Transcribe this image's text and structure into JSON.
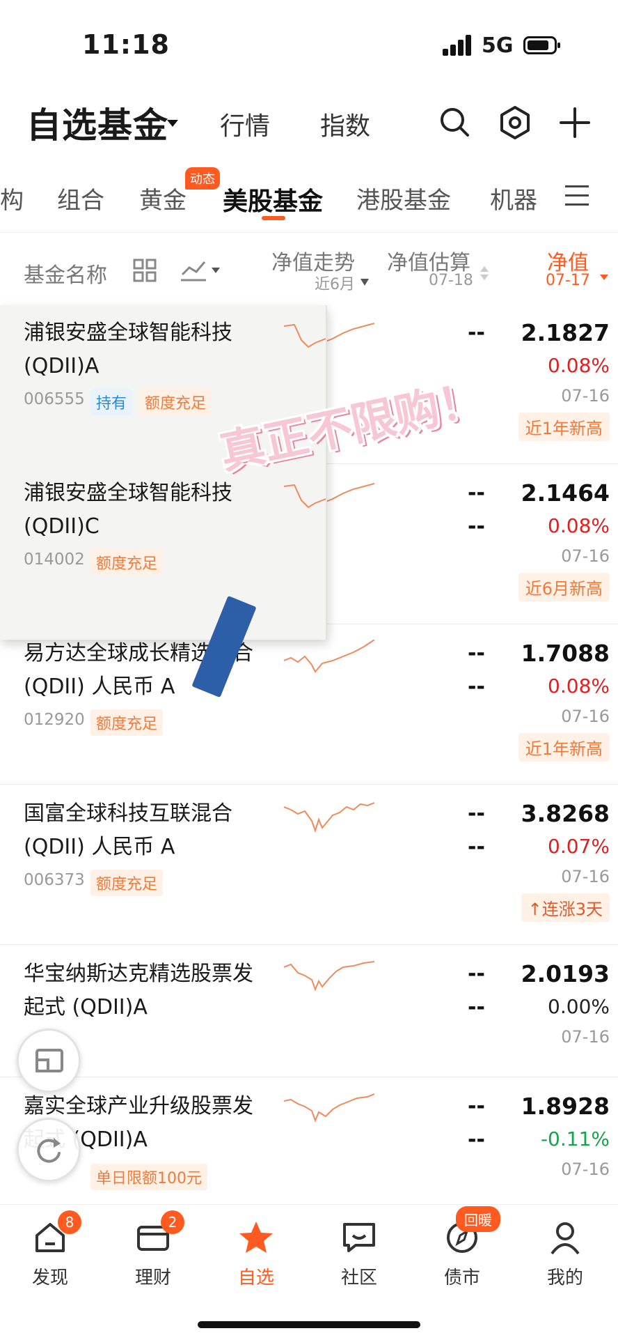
{
  "status": {
    "time": "11:18",
    "network": "5G"
  },
  "header": {
    "title": "自选基金",
    "nav": [
      "行情",
      "指数"
    ]
  },
  "tabs": {
    "items": [
      "构",
      "组合",
      "黄金",
      "美股基金",
      "港股基金",
      "机器"
    ],
    "active": "美股基金",
    "badge": "动态"
  },
  "columns": {
    "name": "基金名称",
    "trend": "净值走势",
    "trend_sub": "近6月",
    "estimate": "净值估算",
    "estimate_sub": "07-18",
    "nav": "净值",
    "nav_sub": "07-17"
  },
  "funds": [
    {
      "name": "浦银安盛全球智能科技 (QDII)A",
      "code": "006555",
      "chips": [
        "持有",
        "额度充足"
      ],
      "est1": "--",
      "est2": "",
      "nav": "2.1827",
      "pct": "0.08%",
      "dir": "up",
      "date": "07-16",
      "tag": "近1年新高"
    },
    {
      "name": "浦银安盛全球智能科技 (QDII)C",
      "code": "014002",
      "chips": [
        "额度充足"
      ],
      "est1": "--",
      "est2": "--",
      "nav": "2.1464",
      "pct": "0.08%",
      "dir": "up",
      "date": "07-16",
      "tag": "近6月新高"
    },
    {
      "name": "易方达全球成长精选混合 (QDII) 人民币 A",
      "code": "012920",
      "chips": [
        "额度充足"
      ],
      "est1": "--",
      "est2": "--",
      "nav": "1.7088",
      "pct": "0.08%",
      "dir": "up",
      "date": "07-16",
      "tag": "近1年新高"
    },
    {
      "name": "国富全球科技互联混合 (QDII) 人民币 A",
      "code": "006373",
      "chips": [
        "额度充足"
      ],
      "est1": "--",
      "est2": "--",
      "nav": "3.8268",
      "pct": "0.07%",
      "dir": "up",
      "date": "07-16",
      "tag": "连涨3天"
    },
    {
      "name": "华宝纳斯达克精选股票发起式 (QDII)A",
      "code": "",
      "chips": [],
      "est1": "--",
      "est2": "--",
      "nav": "2.0193",
      "pct": "0.00%",
      "dir": "flat",
      "date": "07-16",
      "tag": ""
    },
    {
      "name": "嘉实全球产业升级股票发起式 (QDII)A",
      "code": "",
      "chips": [
        "单日限额100元"
      ],
      "est1": "--",
      "est2": "--",
      "nav": "1.8928",
      "pct": "-0.11%",
      "dir": "down",
      "date": "07-16",
      "tag": ""
    }
  ],
  "overlay": {
    "sticker": "真正不限购！"
  },
  "bottom_nav": [
    {
      "label": "发现",
      "icon": "home-icon",
      "badge": "8"
    },
    {
      "label": "理财",
      "icon": "wallet-icon",
      "badge": "2"
    },
    {
      "label": "自选",
      "icon": "star-icon",
      "badge": ""
    },
    {
      "label": "社区",
      "icon": "chat-icon",
      "badge": ""
    },
    {
      "label": "债市",
      "icon": "compass-icon",
      "badge": "回暖"
    },
    {
      "label": "我的",
      "icon": "user-icon",
      "badge": ""
    }
  ],
  "colors": {
    "accent": "#ff5a1f",
    "up": "#e02020",
    "down": "#16a34a",
    "sparkline": "#f08a5d"
  }
}
